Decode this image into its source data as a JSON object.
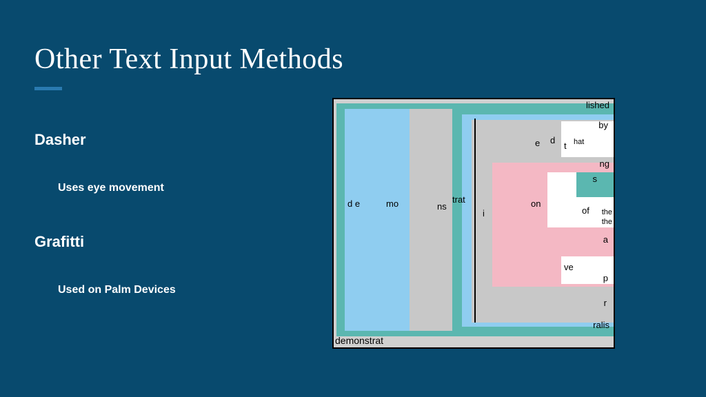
{
  "title": "Other Text Input Methods",
  "sections": [
    {
      "heading": "Dasher",
      "sub": "Uses eye movement"
    },
    {
      "heading": "Grafitti",
      "sub": "Used on Palm Devices"
    }
  ],
  "figure": {
    "status_text": "demonstrat",
    "labels": {
      "lished": "lished",
      "by": "by",
      "e": "e",
      "d": "d",
      "t": "t",
      "hat": "hat",
      "ng": "ng",
      "s": "s",
      "de": "d e",
      "mo": "mo",
      "ns": "ns",
      "trat": "trat",
      "i": "i",
      "on": "on",
      "of": "of",
      "the": "the",
      "the2": "the",
      "ve": "ve",
      "a": "a",
      "p": "p",
      "r": "r",
      "ralis": "ralis"
    }
  }
}
